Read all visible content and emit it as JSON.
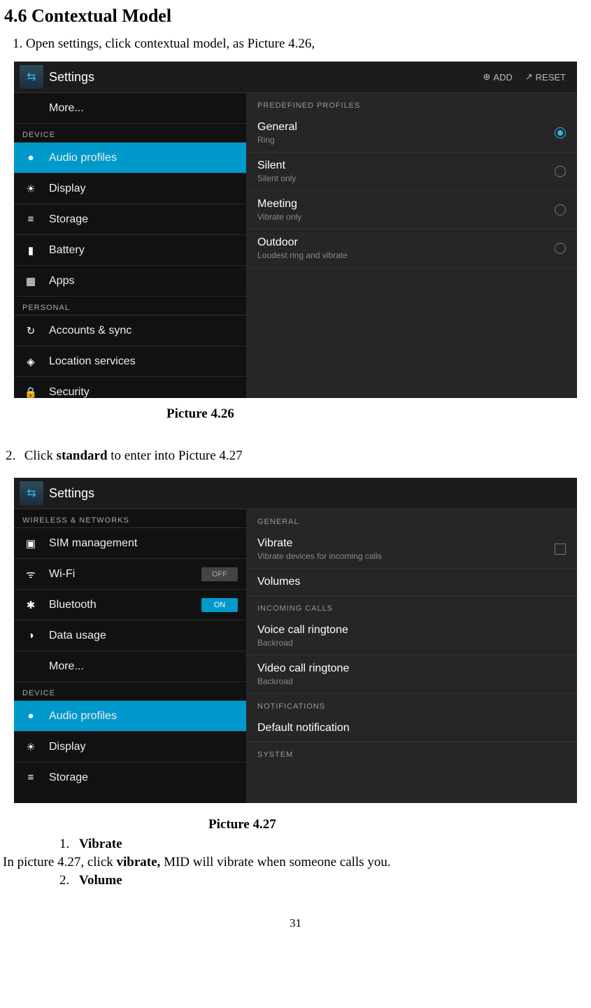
{
  "heading": "4.6 Contextual Model",
  "step1": "1. Open settings, click contextual model, as Picture 4.26,",
  "captionA": "Picture 4.26",
  "step2_num": "2.",
  "step2_text_a": "Click ",
  "step2_bold": "standard",
  "step2_text_b": " to enter into Picture 4.27",
  "captionB": "Picture 4.27",
  "sub1_num": "1.",
  "sub1_title": "Vibrate",
  "sub1_body_a": "In picture 4.27, click ",
  "sub1_body_bold": "vibrate,",
  "sub1_body_b": " MID will vibrate when someone calls you.",
  "sub2_num": "2.",
  "sub2_title": "Volume",
  "page_number": "31",
  "figA": {
    "title": "Settings",
    "add": "ADD",
    "reset": "RESET",
    "left": {
      "more": "More...",
      "catDevice": "DEVICE",
      "items": [
        {
          "icon": "●",
          "label": "Audio profiles",
          "hi": true
        },
        {
          "icon": "☀",
          "label": "Display"
        },
        {
          "icon": "≡",
          "label": "Storage"
        },
        {
          "icon": "▮",
          "label": "Battery"
        },
        {
          "icon": "▦",
          "label": "Apps"
        }
      ],
      "catPersonal": "PERSONAL",
      "items2": [
        {
          "icon": "↻",
          "label": "Accounts & sync"
        },
        {
          "icon": "◈",
          "label": "Location services"
        },
        {
          "icon": "🔒",
          "label": "Security"
        }
      ]
    },
    "right": {
      "cat": "PREDEFINED PROFILES",
      "items": [
        {
          "t1": "General",
          "t2": "Ring",
          "sel": true
        },
        {
          "t1": "Silent",
          "t2": "Silent only"
        },
        {
          "t1": "Meeting",
          "t2": "Vibrate only"
        },
        {
          "t1": "Outdoor",
          "t2": "Loudest ring and vibrate"
        }
      ]
    }
  },
  "figB": {
    "title": "Settings",
    "left": {
      "catWN": "WIRELESS & NETWORKS",
      "items": [
        {
          "icon": "▣",
          "label": "SIM management"
        },
        {
          "icon": "ᯤ",
          "label": "Wi-Fi",
          "toggle": "OFF"
        },
        {
          "icon": "✱",
          "label": "Bluetooth",
          "toggle": "ON"
        },
        {
          "icon": "◑",
          "label": "Data usage"
        },
        {
          "icon": "",
          "label": "More..."
        }
      ],
      "catDevice": "DEVICE",
      "items2": [
        {
          "icon": "●",
          "label": "Audio profiles",
          "hi": true
        },
        {
          "icon": "☀",
          "label": "Display"
        },
        {
          "icon": "≡",
          "label": "Storage"
        }
      ]
    },
    "right": {
      "catGen": "GENERAL",
      "vibrate": {
        "t1": "Vibrate",
        "t2": "Vibrate devices for incoming calls"
      },
      "volumes": "Volumes",
      "catInc": "INCOMING CALLS",
      "voice": {
        "t1": "Voice call ringtone",
        "t2": "Backroad"
      },
      "video": {
        "t1": "Video call ringtone",
        "t2": "Backroad"
      },
      "catNot": "NOTIFICATIONS",
      "def": "Default notification",
      "catSys": "SYSTEM"
    }
  }
}
